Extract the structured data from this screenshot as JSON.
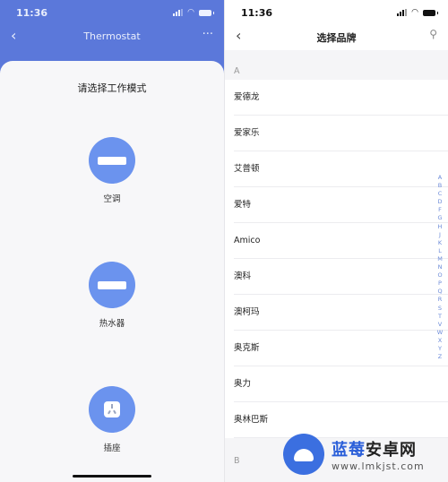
{
  "left": {
    "status": {
      "time": "11:36"
    },
    "navbar": {
      "back": "‹",
      "title": "Thermostat",
      "more": "···"
    },
    "heading": "请选择工作模式",
    "modes": [
      {
        "label": "空调",
        "icon": "air-conditioner-icon"
      },
      {
        "label": "热水器",
        "icon": "water-heater-icon"
      },
      {
        "label": "插座",
        "icon": "socket-icon"
      }
    ],
    "accent": "#6b93ee",
    "header_color": "#5b78da"
  },
  "right": {
    "status": {
      "time": "11:36"
    },
    "navbar": {
      "back": "‹",
      "title": "选择品牌",
      "search": "⚲"
    },
    "sections": [
      {
        "letter": "A",
        "items": [
          "爱德龙",
          "爱家乐",
          "艾普顿",
          "爱特",
          "Amico",
          "澳科",
          "澳柯玛",
          "奥克斯",
          "奥力",
          "奥林巴斯"
        ]
      },
      {
        "letter": "B",
        "items": []
      }
    ],
    "index": [
      "A",
      "B",
      "C",
      "D",
      "F",
      "G",
      "H",
      "J",
      "K",
      "L",
      "M",
      "N",
      "O",
      "P",
      "Q",
      "R",
      "S",
      "T",
      "V",
      "W",
      "X",
      "Y",
      "Z"
    ]
  },
  "watermark": {
    "name_blue": "蓝莓",
    "name_dark": "安卓网",
    "url": "www.lmkjst.com"
  }
}
